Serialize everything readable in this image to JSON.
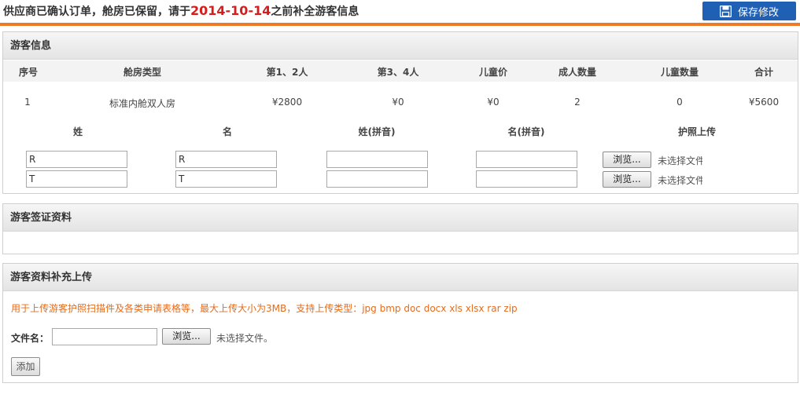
{
  "notice": {
    "prefix": "供应商已确认订单，舱房已保留，请于",
    "date": "2014-10-14",
    "suffix": "之前补全游客信息"
  },
  "save_button": {
    "label": "保存修改",
    "icon": "save-icon"
  },
  "colors": {
    "accent_line": "#ee7a27",
    "primary": "#1f5fb4",
    "date_red": "#d41d1d",
    "tip_orange": "#e56b1b"
  },
  "guest_panel": {
    "title": "游客信息",
    "columns": [
      "序号",
      "舱房类型",
      "第1、2人",
      "第3、4人",
      "儿童价",
      "成人数量",
      "儿童数量",
      "合计"
    ],
    "rows": [
      [
        "1",
        "标准内舱双人房",
        "¥2800",
        "¥0",
        "¥0",
        "2",
        "0",
        "¥5600"
      ]
    ],
    "form_headers": [
      "姓",
      "名",
      "姓(拼音)",
      "名(拼音)",
      "护照上传"
    ],
    "travelers": [
      {
        "surname": "R",
        "given": "R",
        "surname_py": "",
        "given_py": ""
      },
      {
        "surname": "T",
        "given": "T",
        "surname_py": "",
        "given_py": ""
      }
    ],
    "browse_label": "浏览...",
    "no_file_text": "未选择文件"
  },
  "visa_panel": {
    "title": "游客签证资料"
  },
  "upload_panel": {
    "title": "游客资料补充上传",
    "tip": "用于上传游客护照扫描件及各类申请表格等，最大上传大小为3MB，支持上传类型：jpg bmp doc docx xls xlsx rar zip",
    "file_label": "文件名：",
    "file_value": "",
    "browse_label": "浏览...",
    "no_file_text": "未选择文件。",
    "add_label": "添加"
  }
}
